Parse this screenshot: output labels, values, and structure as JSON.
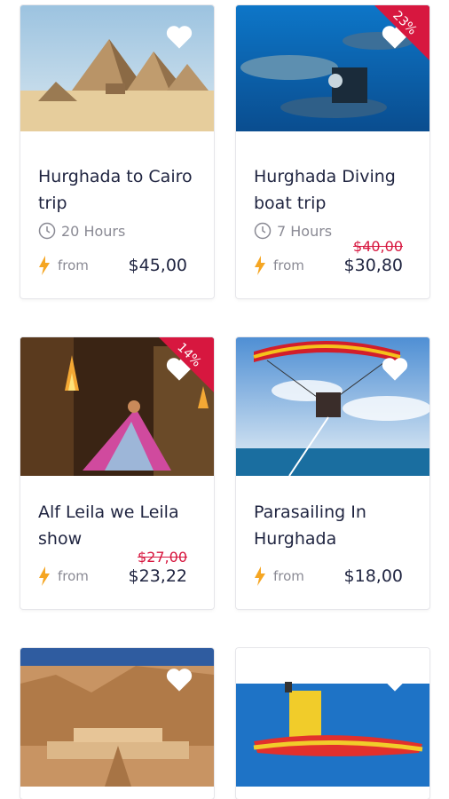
{
  "cards": [
    {
      "title": "Hurghada to Cairo trip",
      "duration": "20 Hours",
      "from_label": "from",
      "price": "$45,00",
      "old_price": "",
      "discount": ""
    },
    {
      "title": "Hurghada Diving boat trip",
      "duration": "7 Hours",
      "from_label": "from",
      "price": "$30,80",
      "old_price": "$40,00",
      "discount": "23%"
    },
    {
      "title": "Alf Leila we Leila show",
      "duration": "",
      "from_label": "from",
      "price": "$23,22",
      "old_price": "$27,00",
      "discount": "14%"
    },
    {
      "title": "Parasailing In Hurghada",
      "duration": "",
      "from_label": "from",
      "price": "$18,00",
      "old_price": "",
      "discount": ""
    },
    {
      "title": "",
      "duration": "",
      "from_label": "",
      "price": "",
      "old_price": "",
      "discount": ""
    },
    {
      "title": "",
      "duration": "",
      "from_label": "",
      "price": "",
      "old_price": "",
      "discount": ""
    }
  ],
  "colors": {
    "discount_ribbon": "#d7173f",
    "price": "#1f2440",
    "old_price": "#d7173f",
    "bolt": "#f5a623"
  },
  "icons": [
    "heart-icon",
    "clock-icon",
    "bolt-icon"
  ]
}
